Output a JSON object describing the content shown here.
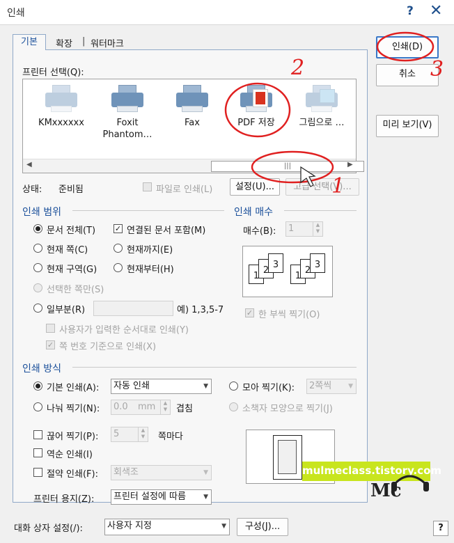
{
  "window": {
    "title": "인쇄",
    "help_glyph": "?",
    "close_glyph": "✕"
  },
  "tabs": [
    {
      "label": "기본"
    },
    {
      "label": "확장"
    },
    {
      "label": "|"
    },
    {
      "label": "워터마크"
    }
  ],
  "side_buttons": {
    "print": "인쇄(D)",
    "cancel": "취소",
    "preview": "미리 보기(V)"
  },
  "printer_select": {
    "label": "프린터 선택(Q):",
    "printers": [
      {
        "name": "KMxxxxxx",
        "icon": "printer-icon"
      },
      {
        "name": "Foxit Phantom…",
        "icon": "printer-icon"
      },
      {
        "name": "Fax",
        "icon": "fax-printer-icon"
      },
      {
        "name": "PDF 저장",
        "icon": "pdf-printer-icon"
      },
      {
        "name": "그림으로 …",
        "icon": "image-printer-icon"
      }
    ],
    "scroll_thumb_glyph": "|||"
  },
  "status": {
    "label": "상태:",
    "value": "준비됨",
    "print_to_file": "파일로 인쇄(L)",
    "settings_button": "설정(U)...",
    "advanced_button": "고급 선택(V)..."
  },
  "print_range": {
    "header": "인쇄 범위",
    "all_document": "문서 전체(T)",
    "include_linked": "연결된 문서 포함(M)",
    "current_page": "현재 쪽(C)",
    "until_current": "현재까지(E)",
    "current_section": "현재 구역(G)",
    "from_current": "현재부터(H)",
    "selected_pages": "선택한 쪽만(S)",
    "partial": "일부분(R)",
    "partial_example": "예) 1,3,5-7",
    "user_order": "사용자가 입력한 순서대로 인쇄(Y)",
    "by_page_number": "쪽 번호 기준으로 인쇄(X)"
  },
  "copies": {
    "header": "인쇄 매수",
    "count_label": "매수(B):",
    "count_value": "1",
    "collate": "한 부씩 찍기(O)",
    "sheet_numbers": [
      "1",
      "2",
      "3"
    ]
  },
  "print_method": {
    "header": "인쇄 방식",
    "basic": "기본 인쇄(A):",
    "basic_value": "자동 인쇄",
    "gather": "모아 찍기(K):",
    "gather_value": "2쪽씩",
    "split": "나눠 찍기(N):",
    "split_value": "0.0",
    "split_unit": "mm",
    "overlap": "겹침",
    "booklet": "소책자 모양으로 찍기(J)",
    "cut": "끊어 찍기(P):",
    "cut_value": "5",
    "cut_unit": "쪽마다",
    "reverse": "역순 인쇄(I)",
    "save": "절약 인쇄(F):",
    "save_value": "회색조",
    "paper_label": "프린터 용지(Z):",
    "paper_value": "프린터 설정에 따름"
  },
  "footer": {
    "dialog_settings_label": "대화 상자 설정(/):",
    "dialog_settings_value": "사용자 지정",
    "config_button": "구성(J)...",
    "help_glyph": "?"
  },
  "annotations": {
    "one": "1",
    "two": "2",
    "three": "3"
  },
  "watermark": {
    "text": "mulmeclass.tistory.com",
    "logo": "Mc"
  },
  "colors": {
    "accent": "#1a4f9a",
    "annotation_red": "#e02020",
    "watermark_bg": "#c8e51e"
  }
}
